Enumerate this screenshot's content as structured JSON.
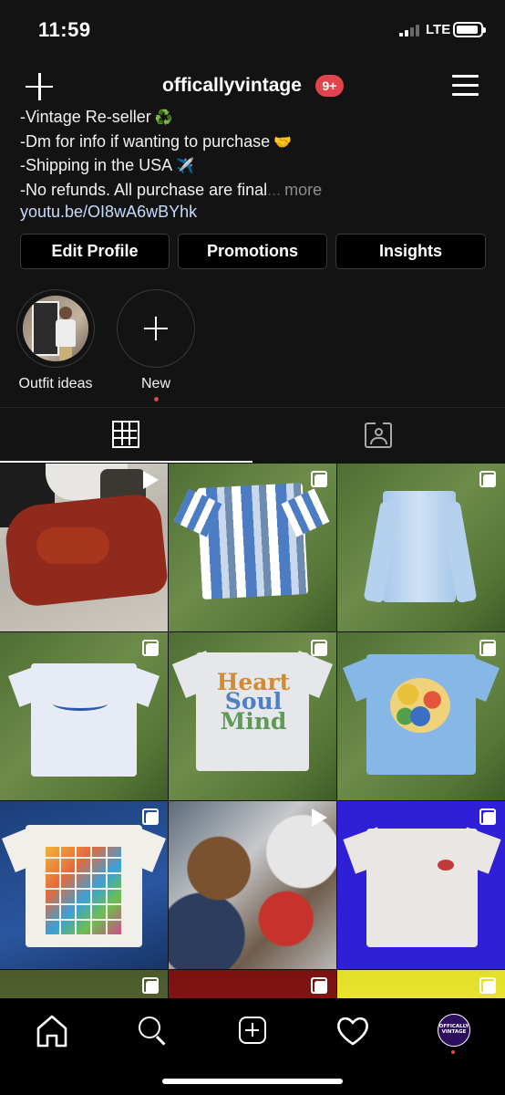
{
  "status_bar": {
    "time": "11:59",
    "network": "LTE"
  },
  "header": {
    "username": "officallyvintage",
    "notification_badge": "9+"
  },
  "bio": {
    "lines": [
      {
        "text": "-Vintage Re-seller",
        "emoji": "♻️"
      },
      {
        "text": "-Dm for info if wanting to purchase",
        "emoji": "🤝"
      },
      {
        "text": "-Shipping in the USA",
        "emoji": "✈️"
      },
      {
        "text": "-No refunds. All purchase are final",
        "more": "more"
      }
    ],
    "link": "youtu.be/OI8wA6wBYhk"
  },
  "actions": {
    "edit_profile": "Edit Profile",
    "promotions": "Promotions",
    "insights": "Insights"
  },
  "highlights": [
    {
      "label": "Outfit ideas"
    },
    {
      "label": "New"
    }
  ],
  "tabs": [
    {
      "icon": "grid-icon",
      "active": true
    },
    {
      "icon": "tagged-icon",
      "active": false
    }
  ],
  "posts": [
    {
      "type": "video",
      "subject": "red jacket pile"
    },
    {
      "type": "carousel",
      "subject": "striped shirt"
    },
    {
      "type": "carousel",
      "subject": "light blue button shirt"
    },
    {
      "type": "carousel",
      "subject": "white tee"
    },
    {
      "type": "carousel",
      "subject": "Heart Soul Mind tee",
      "print": [
        "Heart",
        "Soul",
        "Mind"
      ]
    },
    {
      "type": "carousel",
      "subject": "Pokemon tee"
    },
    {
      "type": "carousel",
      "subject": "cartoon grid tee"
    },
    {
      "type": "video",
      "subject": "clothes pile"
    },
    {
      "type": "carousel",
      "subject": "white tee on blue"
    },
    {
      "type": "carousel",
      "subject": "partial"
    },
    {
      "type": "carousel",
      "subject": "partial"
    },
    {
      "type": "carousel",
      "subject": "partial"
    }
  ],
  "bottom_nav": {
    "items": [
      "home-icon",
      "search-icon",
      "new-post-icon",
      "activity-heart-icon",
      "profile-avatar"
    ],
    "profile_avatar_text": "OFFICALLY VINTAGE"
  },
  "colors": {
    "background": "#131313",
    "badge": "#e2444e",
    "link": "#c7dbff",
    "button_border": "#3a3a3a"
  }
}
